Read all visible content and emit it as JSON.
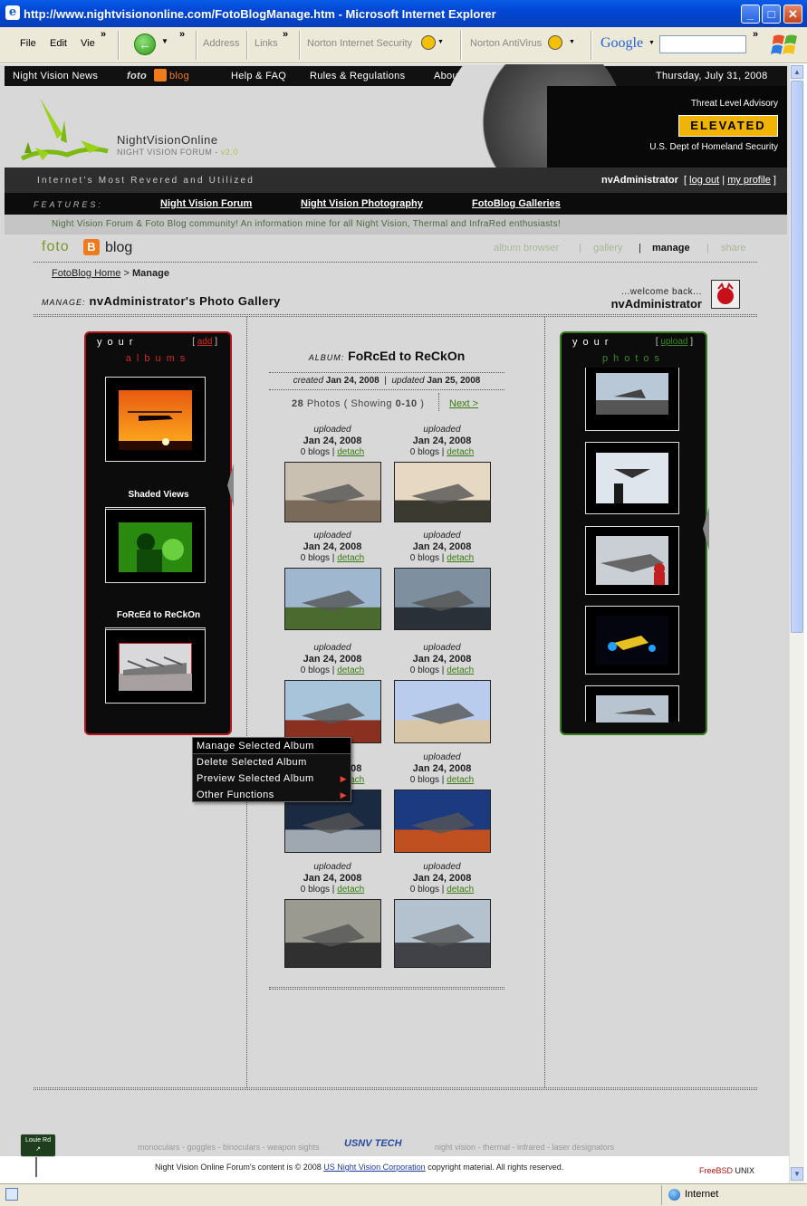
{
  "window": {
    "title": "http://www.nightvisiononline.com/FotoBlogManage.htm - Microsoft Internet Explorer",
    "min": "_",
    "max": "□",
    "close": "✕"
  },
  "toolbar": {
    "file": "File",
    "edit": "Edit",
    "view": "Vie",
    "address": "Address",
    "links": "Links",
    "norton_is": "Norton Internet Security",
    "norton_av": "Norton AntiVirus",
    "google": "Google",
    "chev": "»"
  },
  "statusbar": {
    "zone": "Internet"
  },
  "site": {
    "nav": [
      "Night Vision News",
      "Help & FAQ",
      "Rules & Regulations",
      "About NVOF"
    ],
    "nav_foto": "foto",
    "nav_blog": "blog",
    "date": "Thursday, July 31, 2008",
    "name": "NightVisionOnline",
    "forum": "NIGHT VISION FORUM -",
    "version": "v2.0",
    "threat_title": "Threat Level Advisory",
    "threat_level": "ELEVATED",
    "threat_source": "U.S. Dept of Homeland Security",
    "tagline": "Internet's Most Revered and Utilized",
    "username": "nvAdministrator",
    "logout": "log out",
    "profile": "my profile",
    "features_label": "FEATURES:",
    "features": [
      "Night Vision Forum",
      "Night Vision Photography",
      "FotoBlog Galleries"
    ],
    "community": "Night Vision Forum & Foto Blog community! An information mine for all Night Vision, Thermal and InfraRed enthusiasts!"
  },
  "fotoblog": {
    "logo_foto": "foto",
    "logo_b": "B",
    "logo_blog": "blog",
    "tabs": [
      "album browser",
      "gallery",
      "manage",
      "share"
    ],
    "crumb_home": "FotoBlog Home",
    "crumb_sep": ">",
    "crumb_current": "Manage",
    "manage_label": "MANAGE:",
    "gallery_title": "nvAdministrator's Photo Gallery",
    "welcome": "...welcome back...",
    "welcome_name": "nvAdministrator"
  },
  "albums_panel": {
    "title": "your",
    "action": "add",
    "subtitle": "albums",
    "albums": [
      "",
      "Shaded Views",
      "FoRcEd to ReCkOn"
    ]
  },
  "photos_panel": {
    "title": "your",
    "action": "upload",
    "subtitle": "photos"
  },
  "album": {
    "label": "ALBUM:",
    "name": "FoRcEd to ReCkOn",
    "created_label": "created",
    "created": "Jan 24, 2008",
    "updated_label": "updated",
    "updated": "Jan 25, 2008",
    "count": "28",
    "photos_word": "Photos ( Showing",
    "range": "0-10",
    "close_paren": ")",
    "next": "Next >",
    "items": [
      {
        "uploaded": "uploaded",
        "date": "Jan 24, 2008",
        "blogs": "0 blogs",
        "detach": "detach"
      },
      {
        "uploaded": "uploaded",
        "date": "Jan 24, 2008",
        "blogs": "0 blogs",
        "detach": "detach"
      },
      {
        "uploaded": "uploaded",
        "date": "Jan 24, 2008",
        "blogs": "0 blogs",
        "detach": "detach"
      },
      {
        "uploaded": "uploaded",
        "date": "Jan 24, 2008",
        "blogs": "0 blogs",
        "detach": "detach"
      },
      {
        "uploaded": "uploaded",
        "date": "Jan 24, 2008",
        "blogs": "0 blogs",
        "detach": "detach"
      },
      {
        "uploaded": "uploaded",
        "date": "Jan 24, 2008",
        "blogs": "0 blogs",
        "detach": "detach"
      },
      {
        "uploaded": "uploaded",
        "date": "Jan 24, 2008",
        "blogs": "0 blogs",
        "detach": "detach"
      },
      {
        "uploaded": "uploaded",
        "date": "Jan 24, 2008",
        "blogs": "0 blogs",
        "detach": "detach"
      },
      {
        "uploaded": "uploaded",
        "date": "Jan 24, 2008",
        "blogs": "0 blogs",
        "detach": "detach"
      },
      {
        "uploaded": "uploaded",
        "date": "Jan 24, 2008",
        "blogs": "0 blogs",
        "detach": "detach"
      }
    ]
  },
  "context_menu": {
    "items": [
      "Manage Selected Album",
      "Delete Selected Album",
      "Preview Selected Album",
      "Other Functions"
    ]
  },
  "footer": {
    "links_left": "monoculars - goggles - binoculars - weapon sights",
    "brand": "USNV TECH",
    "links_right": "night vision - thermal - infrared - laser designators",
    "copy_pre": "Night Vision Online Forum's content is © 2008",
    "copy_link": "US Night Vision Corporation",
    "copy_post": "copyright material. All rights reserved.",
    "freebsd": "FreeBSD",
    "unix": "UNIX",
    "sign": "Louie Rd"
  }
}
